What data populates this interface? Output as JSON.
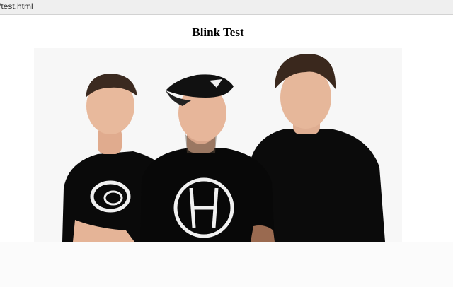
{
  "browser": {
    "url_fragment": "/test.html"
  },
  "page": {
    "title": "Blink Test"
  },
  "image": {
    "subject": "band-photo",
    "colors": {
      "shirt": "#0a0a0a",
      "skin": "#e7b69a",
      "hair": "#3a2a1f",
      "cap": "#111111",
      "logo": "#f0f0f0"
    }
  }
}
